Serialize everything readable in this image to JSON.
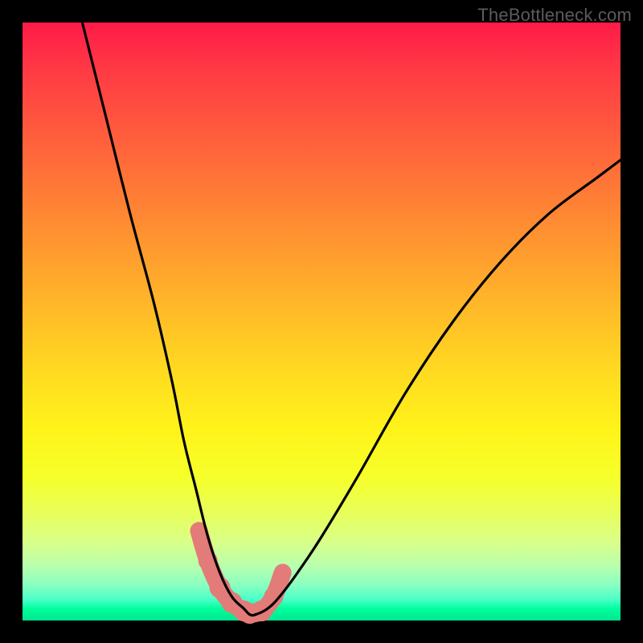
{
  "watermark": "TheBottleneck.com",
  "chart_data": {
    "type": "line",
    "title": "",
    "xlabel": "",
    "ylabel": "",
    "xlim": [
      0,
      100
    ],
    "ylim": [
      0,
      100
    ],
    "series": [
      {
        "name": "bottleneck-curve",
        "x": [
          10,
          14,
          18,
          22,
          25,
          27,
          29,
          31,
          33,
          35,
          37,
          38,
          39,
          41,
          43,
          46,
          50,
          56,
          64,
          72,
          80,
          88,
          96,
          100
        ],
        "values": [
          100,
          84,
          68,
          53,
          40,
          30,
          22,
          14,
          8,
          4,
          2,
          1,
          1,
          2,
          4,
          8,
          14,
          24,
          38,
          50,
          60,
          68,
          74,
          77
        ]
      }
    ],
    "markers": {
      "name": "highlight-band",
      "x": [
        29.5,
        31.0,
        33.0,
        35.0,
        37.0,
        38.0,
        40.0,
        42.0,
        43.5
      ],
      "values": [
        15.0,
        10.0,
        5.5,
        3.0,
        1.6,
        1.2,
        1.6,
        4.0,
        8.0
      ],
      "radius": [
        10,
        12,
        13,
        13,
        13,
        13,
        13,
        12,
        10
      ]
    },
    "colors": {
      "curve": "#000000",
      "marker": "#e37b78",
      "gradient_top": "#ff1b49",
      "gradient_mid": "#ffe81a",
      "gradient_bottom": "#00ff9c"
    }
  }
}
